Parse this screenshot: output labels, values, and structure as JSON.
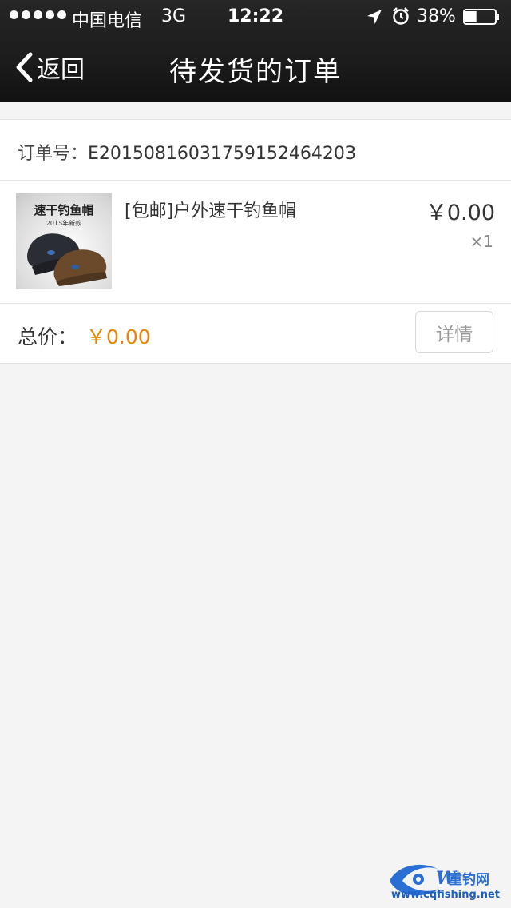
{
  "status_bar": {
    "carrier": "中国电信",
    "network": "3G",
    "time": "12:22",
    "battery": "38%",
    "battery_level": 0.38
  },
  "nav": {
    "back_label": "返回",
    "title": "待发货的订单"
  },
  "order": {
    "number_label": "订单号：",
    "number": "E2015081603175915246420З"
  },
  "item": {
    "name": "[包邮]户外速干钓鱼帽",
    "price": "￥0.00",
    "qty": "×1",
    "thumb_title": "速干钓鱼帽",
    "thumb_subtitle": "2015年新款"
  },
  "total": {
    "label": "总价：",
    "value": "￥0.00"
  },
  "detail_button": "详情",
  "watermark": {
    "name": "重钓网",
    "url": "www.cqfishing.net"
  },
  "colors": {
    "accent": "#f08300",
    "nav_bg": "#1c1c1c",
    "page_bg": "#f4f4f4"
  }
}
